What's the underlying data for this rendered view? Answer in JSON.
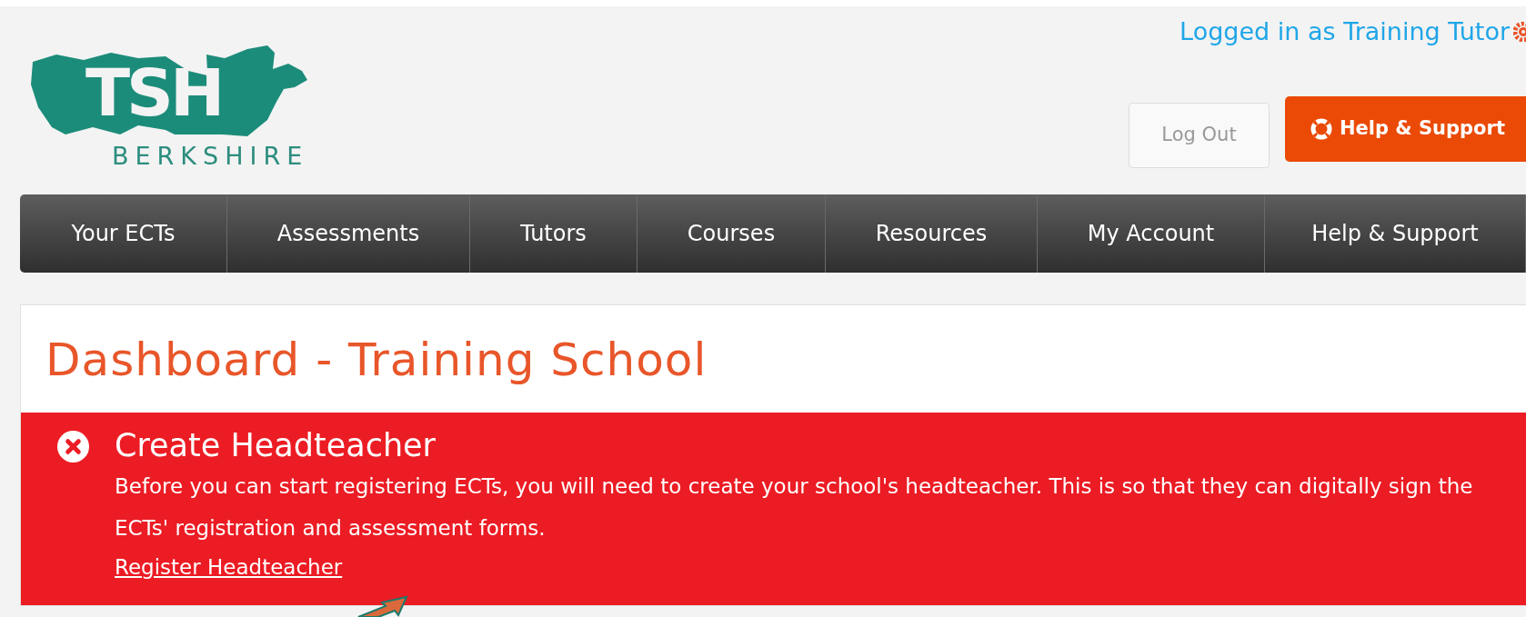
{
  "header": {
    "logo": {
      "mark": "TSH",
      "region": "BERKSHIRE"
    },
    "user_link": "Logged in as Training Tutor",
    "buttons": [
      {
        "label": "Log Out",
        "kind": "secondary"
      },
      {
        "label": "Help & Support",
        "kind": "primary"
      }
    ]
  },
  "nav": {
    "items": [
      "Your ECTs",
      "Assessments",
      "Tutors",
      "Courses",
      "Resources",
      "My Account",
      "Help & Support"
    ]
  },
  "page": {
    "title": "Dashboard - Training School"
  },
  "alert": {
    "kind": "error",
    "title": "Create Headteacher",
    "message": "Before you can start registering ECTs, you will need to create your school's headteacher. This is so that they can digitally sign the ECTs' registration and assessment forms.",
    "link": "Register Headteacher"
  }
}
